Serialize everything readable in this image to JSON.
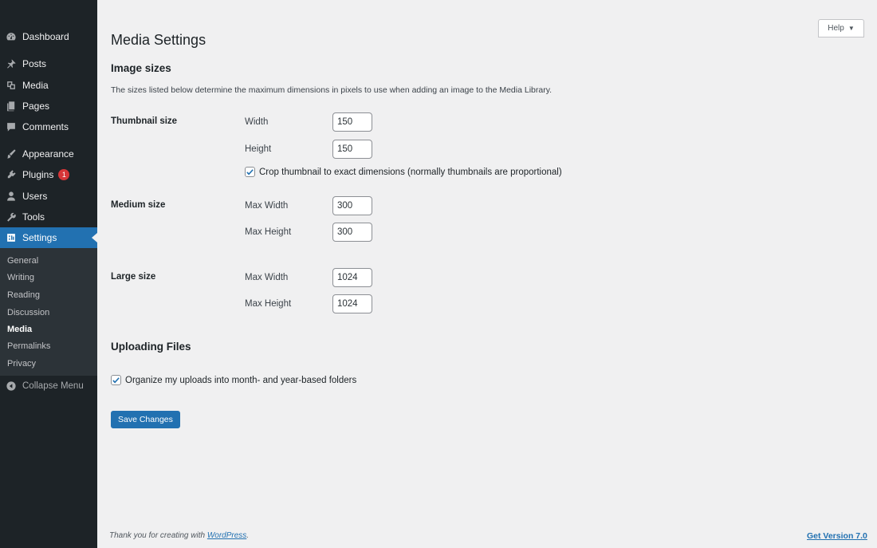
{
  "sidebar": {
    "items": [
      {
        "label": "Dashboard",
        "icon": "dashboard-icon"
      },
      {
        "label": "Posts",
        "icon": "pin-icon"
      },
      {
        "label": "Media",
        "icon": "media-icon"
      },
      {
        "label": "Pages",
        "icon": "pages-icon"
      },
      {
        "label": "Comments",
        "icon": "comment-icon"
      },
      {
        "label": "Appearance",
        "icon": "brush-icon"
      },
      {
        "label": "Plugins",
        "icon": "plugin-icon",
        "badge": "1"
      },
      {
        "label": "Users",
        "icon": "user-icon"
      },
      {
        "label": "Tools",
        "icon": "wrench-icon"
      },
      {
        "label": "Settings",
        "icon": "settings-icon",
        "active": true
      }
    ],
    "submenu": [
      "General",
      "Writing",
      "Reading",
      "Discussion",
      "Media",
      "Permalinks",
      "Privacy"
    ],
    "submenu_current": "Media",
    "collapse_label": "Collapse Menu"
  },
  "help_label": "Help",
  "page_title": "Media Settings",
  "image_sizes": {
    "heading": "Image sizes",
    "description": "The sizes listed below determine the maximum dimensions in pixels to use when adding an image to the Media Library.",
    "thumbnail": {
      "label": "Thumbnail size",
      "width_label": "Width",
      "width_value": "150",
      "height_label": "Height",
      "height_value": "150",
      "crop_label": "Crop thumbnail to exact dimensions (normally thumbnails are proportional)",
      "crop_checked": true
    },
    "medium": {
      "label": "Medium size",
      "width_label": "Max Width",
      "width_value": "300",
      "height_label": "Max Height",
      "height_value": "300"
    },
    "large": {
      "label": "Large size",
      "width_label": "Max Width",
      "width_value": "1024",
      "height_label": "Max Height",
      "height_value": "1024"
    }
  },
  "uploading": {
    "heading": "Uploading Files",
    "organize_label": "Organize my uploads into month- and year-based folders",
    "organize_checked": true
  },
  "save_label": "Save Changes",
  "footer": {
    "thanks_prefix": "Thank you for creating with ",
    "wordpress_link": "WordPress",
    "thanks_suffix": ".",
    "version_link": "Get Version 7.0"
  },
  "colors": {
    "accent": "#2271b1",
    "sidebar_bg": "#1d2327",
    "badge": "#d63638"
  }
}
